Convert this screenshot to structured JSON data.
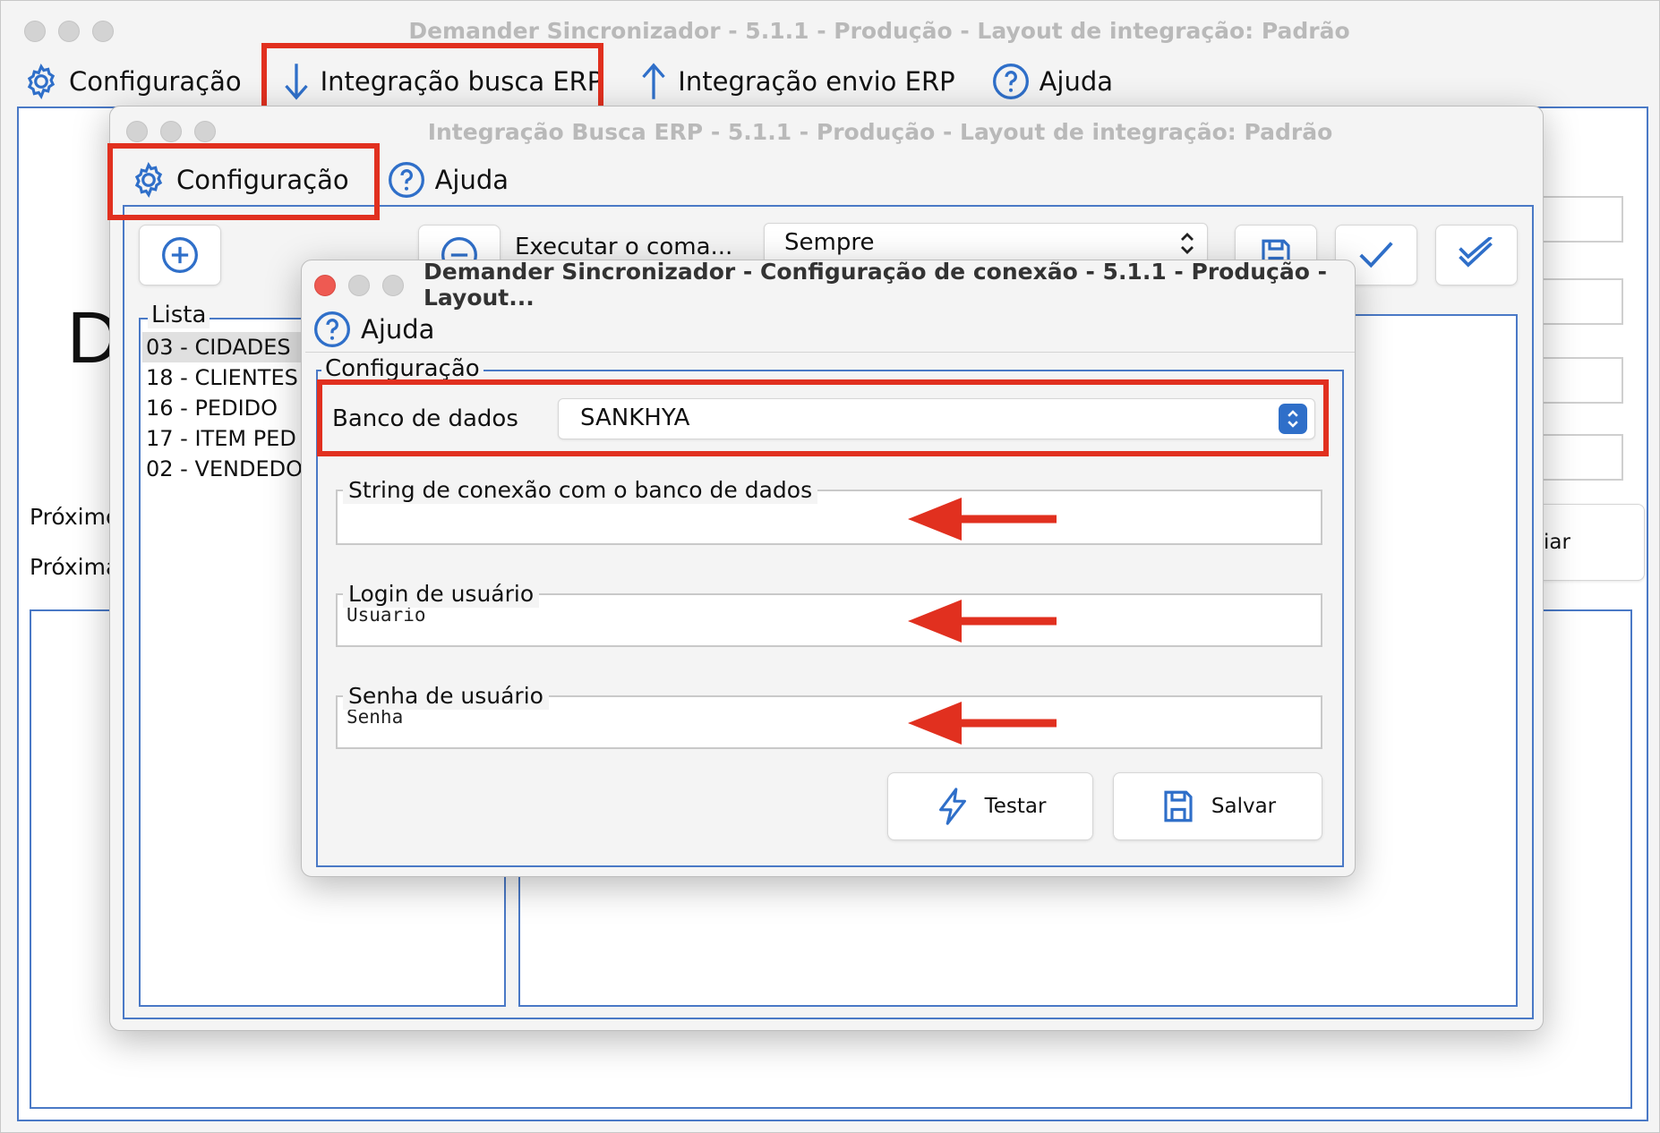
{
  "main_window": {
    "title": "Demander Sincronizador - 5.1.1 - Produção - Layout de integração: Padrão",
    "menu": {
      "configuracao": "Configuração",
      "busca": "Integração busca ERP",
      "envio": "Integração envio ERP",
      "ajuda": "Ajuda"
    },
    "big_letter": "D",
    "label_proximo_1": "Próximo",
    "label_proximo_2": "Próxima",
    "partial_button": "iar"
  },
  "busca_window": {
    "title": "Integração Busca ERP - 5.1.1 - Produção - Layout de integração: Padrão",
    "menu": {
      "configuracao": "Configuração",
      "ajuda": "Ajuda"
    },
    "executar_label": "Executar o coma...",
    "executar_select": "Sempre",
    "lista_legend": "Lista",
    "lista_items": [
      "03 - CIDADES",
      "18 - CLIENTES",
      "16 - PEDIDO",
      "17 - ITEM PED",
      "02 - VENDEDO"
    ]
  },
  "dialog": {
    "title": "Demander Sincronizador - Configuração de conexão - 5.1.1 - Produção - Layout...",
    "menu": {
      "ajuda": "Ajuda"
    },
    "config_legend": "Configuração",
    "banco_label": "Banco de dados",
    "banco_value": "SANKHYA",
    "string_legend": "String de conexão com o banco de dados",
    "string_value": "",
    "login_legend": "Login de usuário",
    "login_value": "Usuario",
    "senha_legend": "Senha de usuário",
    "senha_value": "Senha",
    "btn_testar": "Testar",
    "btn_salvar": "Salvar"
  },
  "colors": {
    "accent": "#2f6fc9",
    "highlight": "#e1301f",
    "close": "#ee5a52"
  }
}
